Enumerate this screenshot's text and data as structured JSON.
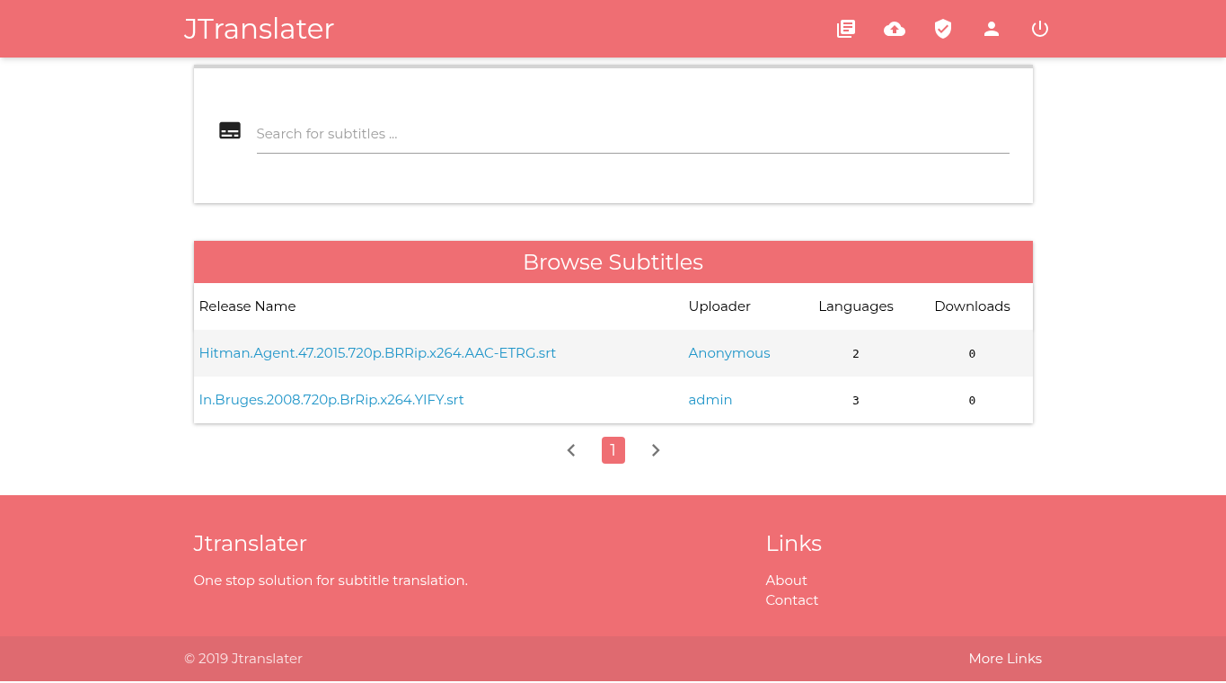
{
  "navbar": {
    "brand": "JTranslater",
    "icons": [
      {
        "kind": "library"
      },
      {
        "kind": "upload"
      },
      {
        "kind": "shield"
      },
      {
        "kind": "user"
      },
      {
        "kind": "power"
      }
    ]
  },
  "search": {
    "placeholder": "Search for subtitles ..."
  },
  "table": {
    "title": "Browse Subtitles",
    "columns": [
      "Release Name",
      "Uploader",
      "Languages",
      "Downloads"
    ],
    "rows": [
      {
        "release": "Hitman.Agent.47.2015.720p.BRRip.x264.AAC-ETRG.srt",
        "uploader": "Anonymous",
        "languages": "2",
        "downloads": "0"
      },
      {
        "release": "In.Bruges.2008.720p.BrRip.x264.YIFY.srt",
        "uploader": "admin",
        "languages": "3",
        "downloads": "0"
      }
    ]
  },
  "pagination": {
    "pages": [
      {
        "label": "1",
        "selected": true
      }
    ]
  },
  "footer": {
    "title": "Jtranslater",
    "text": "One stop solution for subtitle translation.",
    "links_title": "Links",
    "links": [
      "About",
      "Contact"
    ],
    "copyright": "© 2019 Jtranslater",
    "more": "More Links"
  }
}
